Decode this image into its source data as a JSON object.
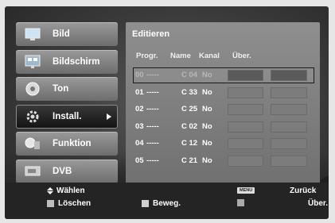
{
  "sidebar": {
    "items": [
      {
        "label": "Bild",
        "icon": "picture-icon"
      },
      {
        "label": "Bildschirm",
        "icon": "screen-icon"
      },
      {
        "label": "Ton",
        "icon": "sound-icon"
      },
      {
        "label": "Install.",
        "icon": "install-icon",
        "active": true
      },
      {
        "label": "Funktion",
        "icon": "function-icon"
      },
      {
        "label": "DVB",
        "icon": "dvb-icon"
      }
    ]
  },
  "panel": {
    "title": "Editieren",
    "columns": {
      "progr": "Progr.",
      "name": "Name",
      "kanal": "Kanal",
      "uber": "Über."
    },
    "rows": [
      {
        "progr": "00",
        "name": "-----",
        "kanal": "C 04",
        "uber": "No",
        "selected": true
      },
      {
        "progr": "01",
        "name": "-----",
        "kanal": "C 33",
        "uber": "No"
      },
      {
        "progr": "02",
        "name": "-----",
        "kanal": "C 25",
        "uber": "No"
      },
      {
        "progr": "03",
        "name": "-----",
        "kanal": "C 02",
        "uber": "No"
      },
      {
        "progr": "04",
        "name": "-----",
        "kanal": "C 12",
        "uber": "No"
      },
      {
        "progr": "05",
        "name": "-----",
        "kanal": "C 21",
        "uber": "No"
      }
    ]
  },
  "footer": {
    "select_label": "Wählen",
    "menu_badge": "MENU",
    "back_label": "Zurück",
    "delete_label": "Löschen",
    "move_label": "Beweg.",
    "skip_label": "Über."
  },
  "colors": {
    "selected_outline": "#1a1a1a",
    "delete_key": "#bdbdbd"
  }
}
